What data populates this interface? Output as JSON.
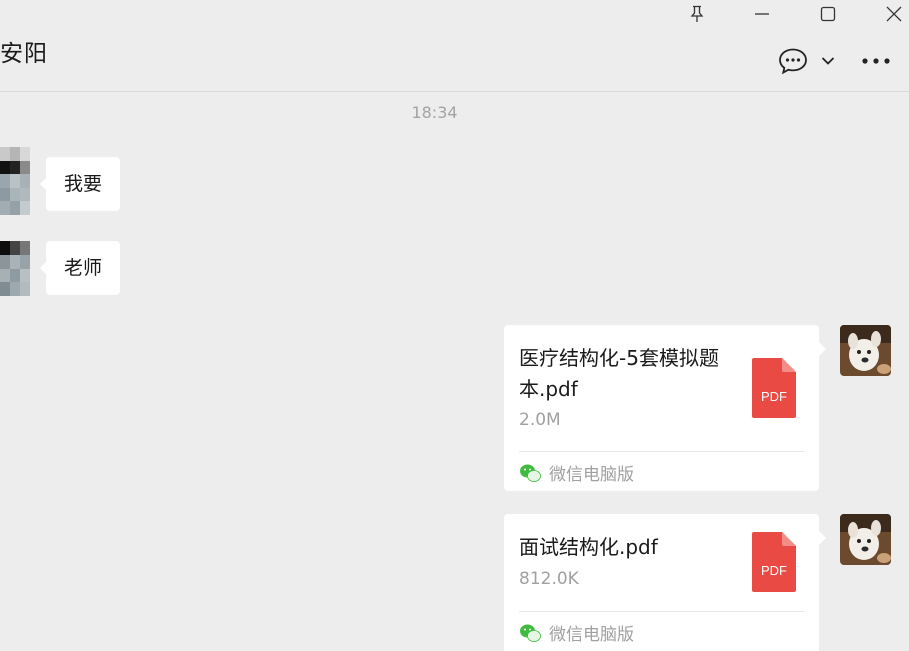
{
  "window": {
    "controls": [
      "pin-icon",
      "minimize-icon",
      "maximize-icon",
      "close-icon"
    ]
  },
  "header": {
    "title": "安阳",
    "icons": [
      "chat-bubble-icon",
      "chevron-down-icon",
      "more-icon"
    ]
  },
  "chat": {
    "timestamp": "18:34",
    "messages": [
      {
        "side": "left",
        "type": "text",
        "text": "我要"
      },
      {
        "side": "left",
        "type": "text",
        "text": "老师"
      },
      {
        "side": "right",
        "type": "file",
        "file_name": "医疗结构化-5套模拟题本.pdf",
        "size": "2.0M",
        "source": "微信电脑版",
        "icon_label": "PDF"
      },
      {
        "side": "right",
        "type": "file",
        "file_name": "面试结构化.pdf",
        "size": "812.0K",
        "source": "微信电脑版",
        "icon_label": "PDF"
      }
    ]
  },
  "colors": {
    "background": "#ededed",
    "bubble": "#ffffff",
    "pdf_red": "#e94a44",
    "wechat_green": "#3fbb3f",
    "muted_text": "#a0a0a0"
  }
}
